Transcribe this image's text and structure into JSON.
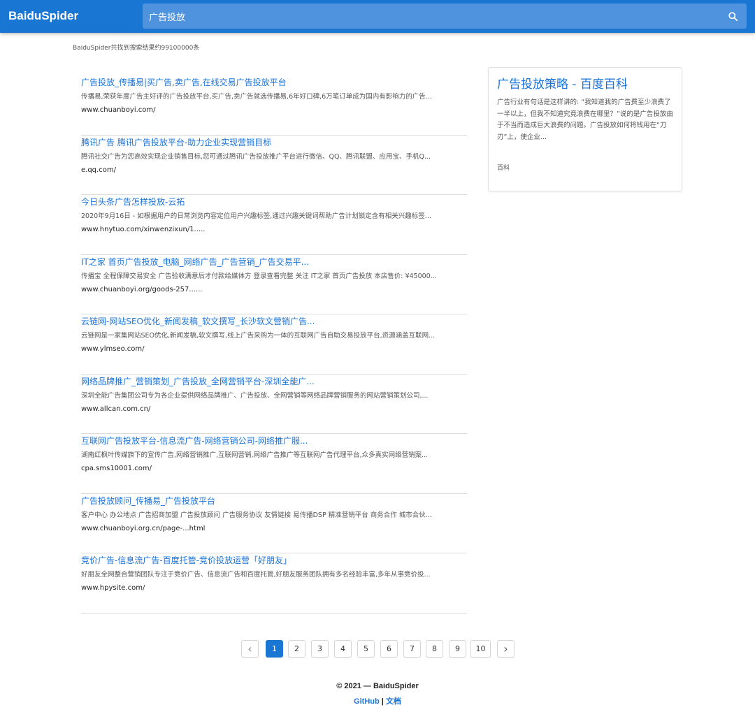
{
  "header": {
    "brand": "BaiduSpider",
    "search_value": "广告投放"
  },
  "summary": "BaiduSpider共找到搜索结果约99100000条",
  "results": [
    {
      "title": "广告投放_传播易|买广告,卖广告,在线交易广告投放平台",
      "desc": "传播易,荣获年度广告主好评的广告投放平台,买广告,卖广告就选传播易,6年好口碑,6万笔订单成为国内有影响力的广告...",
      "url": "www.chuanboyi.com/"
    },
    {
      "title": "腾讯广告 腾讯广告投放平台-助力企业实现营销目标",
      "desc": "腾讯社交广告为您高效实现企业销售目标,您可通过腾讯广告投放推广平台进行微信、QQ、腾讯联盟、应用宝、手机Q...",
      "url": "e.qq.com/"
    },
    {
      "title": "今日头条广告怎样投放-云拓",
      "desc": "2020年9月16日 - 如根据用户的日常浏览内容定位用户兴趣标签,通过兴趣关键词帮助广告计划锁定含有相关兴趣标签...",
      "url": "www.hnytuo.com/xinwenzixun/1....."
    },
    {
      "title": "IT之家 首页广告投放_电脑_网络广告_广告营销_广告交易平...",
      "desc": "传播宝 全程保障交易安全 广告验收满意后才付款给媒体方 登录查看完整 关注 IT之家 首页广告投放 本店售价: ¥45000...",
      "url": "www.chuanboyi.org/goods-257......"
    },
    {
      "title": "云链网-网站SEO优化_新闻发稿_软文撰写_长沙软文营销广告...",
      "desc": "云链网是一家集网站SEO优化,新闻发稿,软文撰写,线上广告采购为一体的互联网广告自助交易投放平台,资源涵盖互联网...",
      "url": "www.ylmseo.com/"
    },
    {
      "title": "网络品牌推广_营销策划_广告投放_全网营销平台-深圳全能广...",
      "desc": "深圳全能广告集团公司专为各企业提供网络品牌推广、广告投放、全网营销等网络品牌营销服务的网站营销策划公司,...",
      "url": "www.allcan.com.cn/"
    },
    {
      "title": "互联网广告投放平台-信息流广告-网络营销公司-网络推广服...",
      "desc": "湖南红枫叶传媒旗下的宣传广告,网络营销推广,互联网营销,网络广告推广等互联网广告代理平台,众多真实网络营销案...",
      "url": "cpa.sms10001.com/"
    },
    {
      "title": "广告投放顾问_传播易_广告投放平台",
      "desc": "客户中心 办公地点 广告招商加盟 广告投放顾问 广告服务协议 友情链接 易传播DSP 精准营销平台 商务合作 城市合伙...",
      "url": "www.chuanboyi.org.cn/page-...html"
    },
    {
      "title": "竞价广告-信息流广告-百度托管-竞价投放运营「好朋友」",
      "desc": "好朋友全网整合营销团队专注于竞价广告、信息流广告和百度托管,好朋友服务团队拥有多名经验丰富,多年从事竞价投...",
      "url": "www.hpysite.com/"
    }
  ],
  "baike": {
    "title": "广告投放策略 - 百度百科",
    "desc": "广告行业有句话是这样讲的: “我知道我的广告费至少浪费了一半以上，但我不知道究竟浪费在哪里？”说的是广告投放由于不当而造成巨大浪费的问题。广告投放如何将钱用在“刀刃”上，使企业...",
    "tag": "百科"
  },
  "pagination": {
    "prev": "‹",
    "next": "›",
    "pages": [
      "1",
      "2",
      "3",
      "4",
      "5",
      "6",
      "7",
      "8",
      "9",
      "10"
    ],
    "current": "1"
  },
  "footer": {
    "copyright": "© 2021 — BaiduSpider",
    "link_github": "GitHub",
    "separator": "|",
    "link_docs": "文档"
  }
}
